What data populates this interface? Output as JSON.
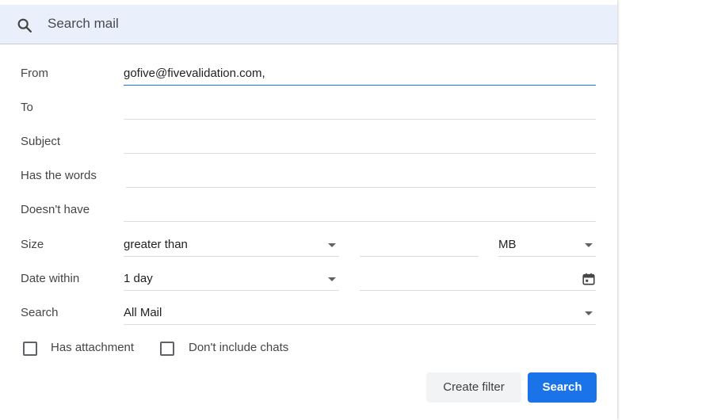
{
  "search": {
    "placeholder": "Search mail"
  },
  "form": {
    "from": {
      "label": "From",
      "value": "gofive@fivevalidation.com,"
    },
    "to": {
      "label": "To",
      "value": ""
    },
    "subject": {
      "label": "Subject",
      "value": ""
    },
    "has_words": {
      "label": "Has the words",
      "value": ""
    },
    "doesnt_have": {
      "label": "Doesn't have",
      "value": ""
    },
    "size": {
      "label": "Size",
      "operator": "greater than",
      "value": "",
      "unit": "MB"
    },
    "date_within": {
      "label": "Date within",
      "range": "1 day",
      "date": ""
    },
    "search_in": {
      "label": "Search",
      "value": "All Mail"
    },
    "has_attachment": {
      "label": "Has attachment",
      "checked": false
    },
    "dont_include_chats": {
      "label": "Don't include chats",
      "checked": false
    }
  },
  "buttons": {
    "create_filter": "Create filter",
    "search": "Search"
  },
  "colors": {
    "accent": "#1a73e8",
    "searchbar_bg": "#e9f0fb"
  }
}
